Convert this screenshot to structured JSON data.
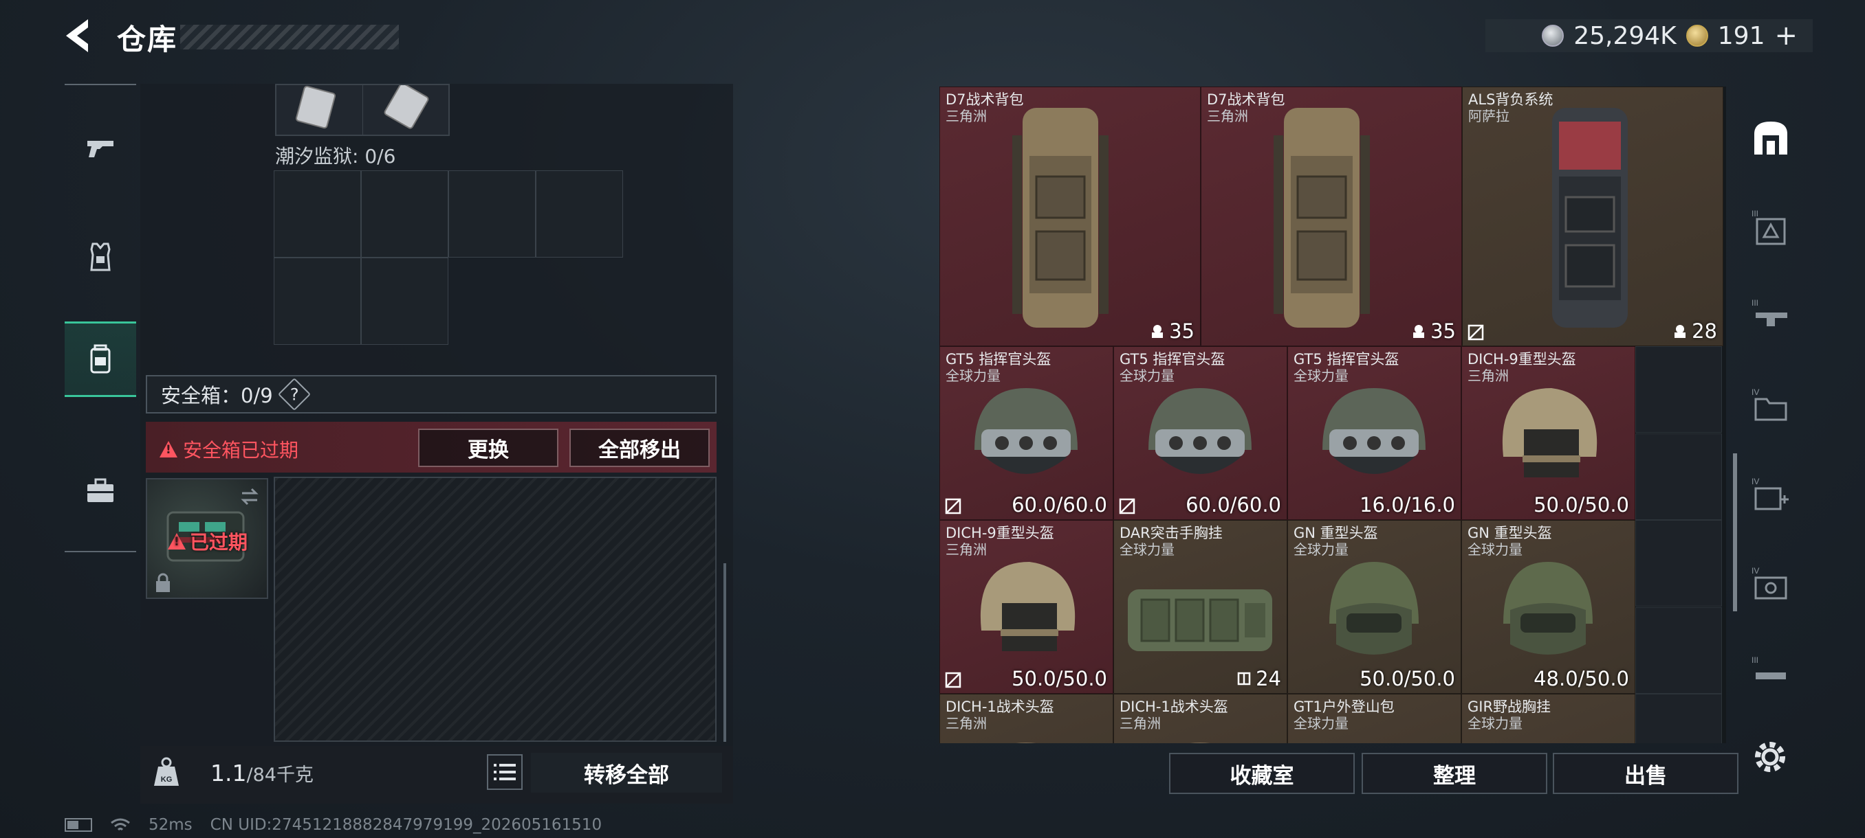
{
  "header": {
    "title": "仓库",
    "currency_silver": "25,294K",
    "currency_gold": "191",
    "add": "+"
  },
  "left_nav": {
    "items": [
      {
        "name": "weapons",
        "icon": "gun-icon"
      },
      {
        "name": "armor",
        "icon": "vest-icon"
      },
      {
        "name": "backpack",
        "icon": "backpack-icon",
        "active": true
      },
      {
        "name": "case",
        "icon": "briefcase-icon"
      }
    ]
  },
  "left_panel": {
    "tidal_prison_label": "潮汐监狱: 0/6",
    "safebox_label": "安全箱：0/9",
    "safebox_help": "?",
    "safebox_expired": "安全箱已过期",
    "replace_button": "更换",
    "remove_all_button": "全部移出",
    "case_expired": "已过期",
    "weight_value": "1.1",
    "weight_max": "/84千克",
    "transfer_all_button": "转移全部"
  },
  "status_bar": {
    "ping": "52ms",
    "uid": "CN UID:27451218882847979199_202605161510"
  },
  "inventory": {
    "items": [
      {
        "name": "D7战术背包",
        "origin": "三角洲",
        "value": "35",
        "tag": "backpack",
        "color": "red"
      },
      {
        "name": "D7战术背包",
        "origin": "三角洲",
        "value": "35",
        "tag": "backpack",
        "color": "red"
      },
      {
        "name": "ALS背负系统",
        "origin": "阿萨拉",
        "value": "28",
        "tag": "backpack",
        "color": "brown"
      },
      {
        "name": "GT5 指挥官头盔",
        "origin": "全球力量",
        "value": "60.0/60.0",
        "tag": "helmet",
        "color": "red"
      },
      {
        "name": "GT5 指挥官头盔",
        "origin": "全球力量",
        "value": "60.0/60.0",
        "tag": "helmet",
        "color": "red"
      },
      {
        "name": "GT5 指挥官头盔",
        "origin": "全球力量",
        "value": "16.0/16.0",
        "tag": "helmet",
        "color": "red"
      },
      {
        "name": "DICH-9重型头盔",
        "origin": "三角洲",
        "value": "50.0/50.0",
        "tag": "helmet",
        "color": "red"
      },
      {
        "name": "DICH-9重型头盔",
        "origin": "三角洲",
        "value": "50.0/50.0",
        "tag": "helmet",
        "color": "red"
      },
      {
        "name": "DAR突击手胸挂",
        "origin": "全球力量",
        "value": "24",
        "tag": "rig",
        "color": "brown"
      },
      {
        "name": "GN 重型头盔",
        "origin": "全球力量",
        "value": "50.0/50.0",
        "tag": "helmet",
        "color": "brown"
      },
      {
        "name": "GN 重型头盔",
        "origin": "全球力量",
        "value": "48.0/50.0",
        "tag": "helmet",
        "color": "brown"
      },
      {
        "name": "DICH-1战术头盔",
        "origin": "三角洲",
        "value": "",
        "tag": "helmet",
        "color": "brown"
      },
      {
        "name": "DICH-1战术头盔",
        "origin": "三角洲",
        "value": "",
        "tag": "helmet",
        "color": "brown"
      },
      {
        "name": "GT1户外登山包",
        "origin": "全球力量",
        "value": "",
        "tag": "backpack",
        "color": "brown"
      },
      {
        "name": "GIR野战胸挂",
        "origin": "全球力量",
        "value": "",
        "tag": "rig",
        "color": "brown"
      }
    ]
  },
  "bottom_actions": {
    "collection_button": "收藏室",
    "sort_button": "整理",
    "sell_button": "出售"
  },
  "right_nav": {
    "tiers": [
      "",
      "III",
      "III",
      "IV",
      "IV",
      "IV",
      "III"
    ]
  },
  "colors": {
    "accent_green": "#39c59a",
    "danger_red": "#ff5560",
    "item_red": "#5a2a32",
    "item_brown": "#4a3e32"
  }
}
